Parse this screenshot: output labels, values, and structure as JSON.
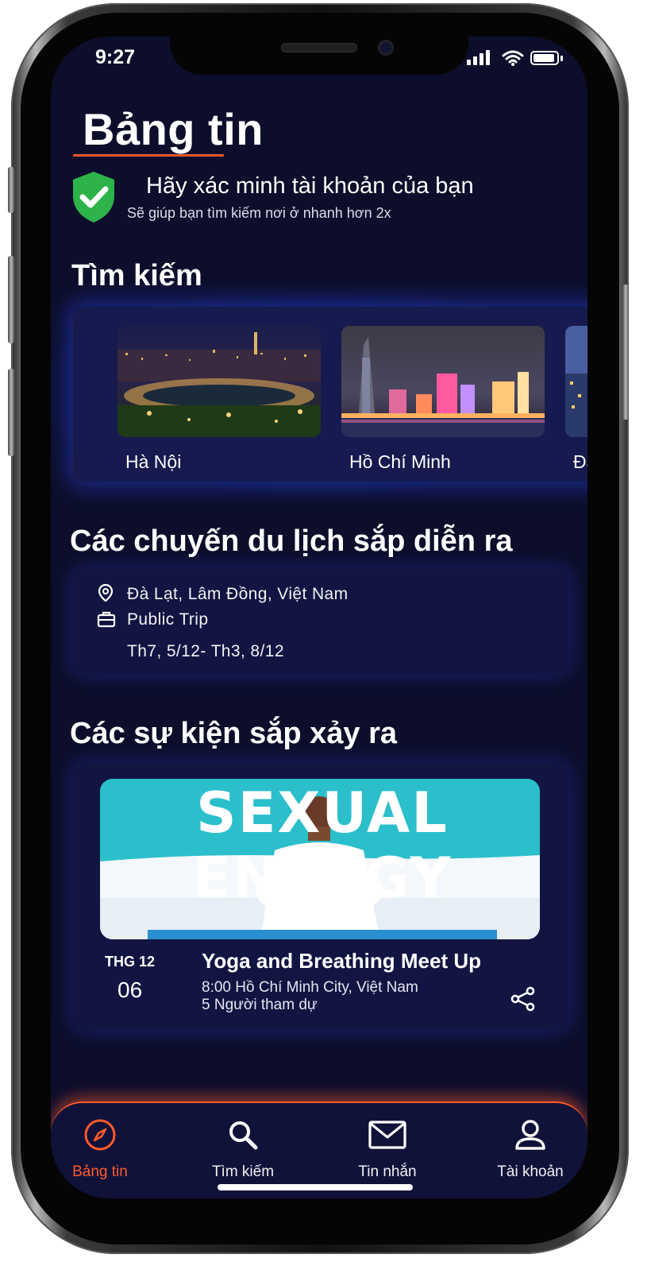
{
  "status_bar": {
    "time": "9:27"
  },
  "header": {
    "title": "Bảng tin"
  },
  "verify": {
    "title": "Hãy xác minh tài khoản của bạn",
    "subtitle": "Sẽ giúp bạn tìm kiếm nơi ở nhanh hơn 2x"
  },
  "search": {
    "title": "Tìm kiếm",
    "cities": [
      {
        "name": "Hà Nội"
      },
      {
        "name": "Hồ Chí Minh"
      },
      {
        "name": "Đà"
      }
    ]
  },
  "trips": {
    "title": "Các chuyến du lịch sắp diễn ra",
    "items": [
      {
        "location": "Đà Lạt, Lâm Đồng, Việt Nam",
        "type": "Public Trip",
        "dates": "Th7, 5/12-  Th3, 8/12"
      }
    ]
  },
  "events": {
    "title": "Các sự kiện sắp xảy ra",
    "items": [
      {
        "image_text": "SEXUAL ENERGY",
        "month": "THG 12",
        "day": "06",
        "name": "Yoga and Breathing Meet Up",
        "location": "8:00 Hồ Chí Minh City, Việt Nam",
        "attendees": "5 Người tham dự"
      }
    ]
  },
  "tabbar": {
    "tabs": [
      {
        "label": "Bảng tin",
        "icon": "compass-icon",
        "active": true
      },
      {
        "label": "Tìm kiếm",
        "icon": "search-icon",
        "active": false
      },
      {
        "label": "Tin nhắn",
        "icon": "mail-icon",
        "active": false
      },
      {
        "label": "Tài khoản",
        "icon": "user-icon",
        "active": false
      }
    ]
  },
  "colors": {
    "background": "#0d0e2b",
    "accent": "#ff5a2a",
    "card": "#161a4e",
    "verify": "#2db34a"
  }
}
